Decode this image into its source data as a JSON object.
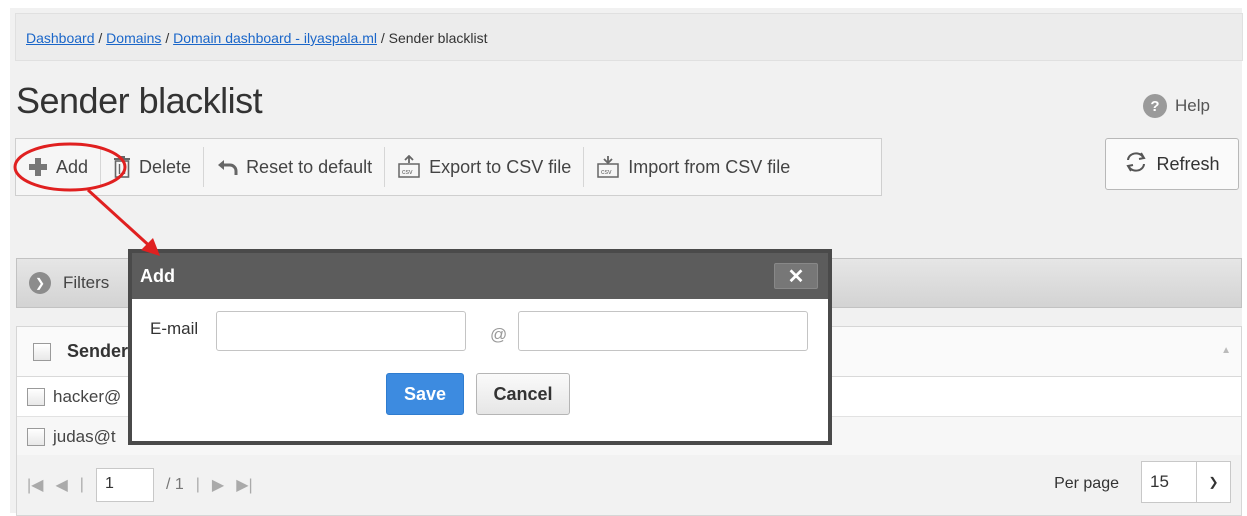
{
  "breadcrumb": {
    "items": [
      "Dashboard",
      "Domains",
      "Domain dashboard - ilyaspala.ml"
    ],
    "current": "Sender blacklist",
    "separator": "/"
  },
  "page": {
    "title": "Sender blacklist",
    "help_label": "Help"
  },
  "toolbar": {
    "add": "Add",
    "delete": "Delete",
    "reset": "Reset to default",
    "export": "Export to CSV file",
    "import": "Import from CSV file",
    "refresh": "Refresh"
  },
  "filters": {
    "label": "Filters"
  },
  "table": {
    "header": "Sender",
    "rows": [
      "hacker@",
      "judas@t"
    ]
  },
  "pager": {
    "page": "1",
    "of": "/ 1",
    "per_page_label": "Per page",
    "per_page_value": "15"
  },
  "modal": {
    "title": "Add",
    "email_label": "E-mail",
    "at": "@",
    "save": "Save",
    "cancel": "Cancel",
    "close": "✕"
  },
  "colors": {
    "accent": "#3d8be0",
    "annotation": "#e02020",
    "modal_header": "#5c5c5c"
  }
}
